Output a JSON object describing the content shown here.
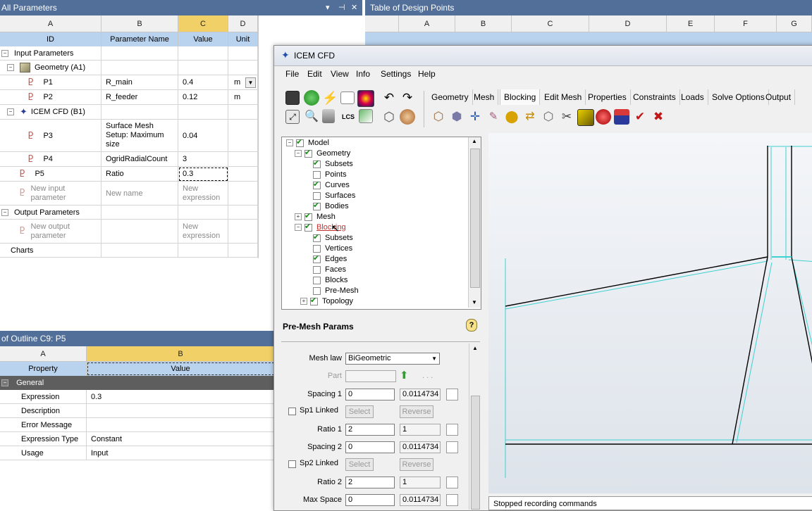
{
  "params_panel": {
    "title": "All Parameters",
    "controls": [
      "▾",
      "⊣",
      "✕"
    ],
    "columns": [
      "A",
      "B",
      "C",
      "D"
    ],
    "headers": [
      "ID",
      "Parameter Name",
      "Value",
      "Unit"
    ],
    "rows": [
      {
        "id": "Input Parameters",
        "name": "",
        "value": "",
        "unit": ""
      },
      {
        "id": "Geometry (A1)",
        "name": "",
        "value": "",
        "unit": ""
      },
      {
        "id": "P1",
        "name": "R_main",
        "value": "0.4",
        "unit": "m"
      },
      {
        "id": "P2",
        "name": "R_feeder",
        "value": "0.12",
        "unit": "m"
      },
      {
        "id": "ICEM CFD (B1)",
        "name": "",
        "value": "",
        "unit": ""
      },
      {
        "id": "P3",
        "name": "Surface Mesh Setup: Maximum size",
        "value": "0.04",
        "unit": ""
      },
      {
        "id": "P4",
        "name": "OgridRadialCount",
        "value": "3",
        "unit": ""
      },
      {
        "id": "P5",
        "name": "Ratio",
        "value": "0.3",
        "unit": ""
      },
      {
        "id": "New input parameter",
        "name": "New name",
        "value": "New expression",
        "unit": ""
      },
      {
        "id": "Output Parameters",
        "name": "",
        "value": "",
        "unit": ""
      },
      {
        "id": "New output parameter",
        "name": "",
        "value": "New expression",
        "unit": ""
      },
      {
        "id": "Charts",
        "name": "",
        "value": "",
        "unit": ""
      }
    ]
  },
  "design_points": {
    "title": "Table of Design Points",
    "columns": [
      "A",
      "B",
      "C",
      "D",
      "E",
      "F",
      "G"
    ]
  },
  "outline_panel": {
    "title": "of Outline C9: P5",
    "columns": [
      "A",
      "B"
    ],
    "headers": [
      "Property",
      "Value"
    ],
    "group": "General",
    "rows": [
      {
        "prop": "Expression",
        "value": "0.3"
      },
      {
        "prop": "Description",
        "value": ""
      },
      {
        "prop": "Error Message",
        "value": ""
      },
      {
        "prop": "Expression Type",
        "value": "Constant"
      },
      {
        "prop": "Usage",
        "value": "Input"
      }
    ]
  },
  "icem": {
    "title": "ICEM CFD",
    "menu": [
      "File",
      "Edit",
      "View",
      "Info",
      "Settings",
      "Help"
    ],
    "tabs": [
      "Geometry",
      "Mesh",
      "Blocking",
      "Edit Mesh",
      "Properties",
      "Constraints",
      "Loads",
      "Solve Options",
      "Output"
    ],
    "active_tab": "Blocking",
    "tree": {
      "root": "Model",
      "geometry": "Geometry",
      "geometry_items": [
        "Subsets",
        "Points",
        "Curves",
        "Surfaces",
        "Bodies"
      ],
      "mesh": "Mesh",
      "blocking": "Blocking",
      "blocking_items": [
        "Subsets",
        "Vertices",
        "Edges",
        "Faces",
        "Blocks",
        "Pre-Mesh",
        "Topology"
      ]
    },
    "premesh": {
      "title": "Pre-Mesh Params",
      "mesh_law_label": "Mesh law",
      "mesh_law_value": "BiGeometric",
      "part_label": "Part",
      "spacing1_label": "Spacing 1",
      "spacing1_value": "0",
      "spacing1_actual": "0.0114734",
      "sp1_linked_label": "Sp1 Linked",
      "select_label": "Select",
      "reverse_label": "Reverse",
      "ratio1_label": "Ratio 1",
      "ratio1_value": "2",
      "ratio1_actual": "1",
      "spacing2_label": "Spacing 2",
      "spacing2_value": "0",
      "spacing2_actual": "0.0114734",
      "sp2_linked_label": "Sp2 Linked",
      "ratio2_label": "Ratio 2",
      "ratio2_value": "2",
      "ratio2_actual": "1",
      "maxspace_label": "Max Space",
      "maxspace_value": "0",
      "maxspace_actual": "0.0114734",
      "dots": ". . ."
    },
    "status": "Stopped recording commands"
  }
}
